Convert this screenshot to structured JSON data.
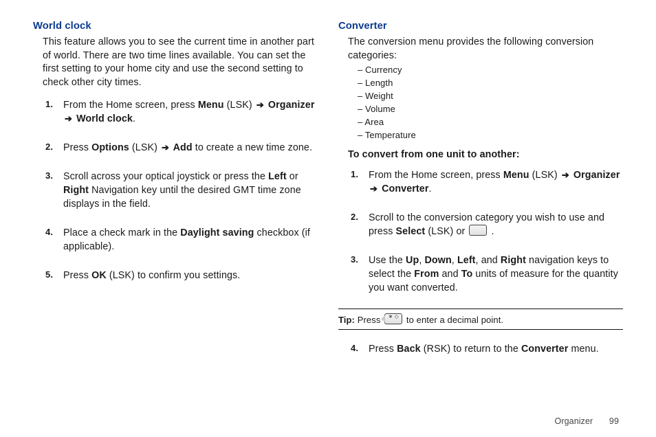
{
  "left": {
    "title": "World clock",
    "intro": "This feature allows you to see the current time in another part of world. There are two time lines available. You can set the first setting to your home city and use the second setting to check other city times.",
    "s1_a": "From the Home screen, press ",
    "s1_menu": "Menu",
    "s1_lsk": " (LSK) ",
    "s1_org": " Organizer ",
    "s1_wc": " World clock",
    "s2_a": "Press ",
    "s2_opt": "Options",
    "s2_lsk": " (LSK) ",
    "s2_add": " Add",
    "s2_tail": " to create a new time zone.",
    "s3_a": "Scroll across your optical joystick or press the ",
    "s3_left": "Left",
    "s3_or": " or ",
    "s3_right": "Right",
    "s3_tail": " Navigation key until the desired GMT time zone displays in the field.",
    "s4_a": "Place a check mark in the ",
    "s4_ds": "Daylight saving",
    "s4_tail": " checkbox (if applicable).",
    "s5_a": "Press ",
    "s5_ok": "OK",
    "s5_tail": " (LSK) to confirm you settings."
  },
  "right": {
    "title": "Converter",
    "intro": "The conversion menu provides the following conversion categories:",
    "cats": [
      "Currency",
      "Length",
      "Weight",
      "Volume",
      "Area",
      "Temperature"
    ],
    "subheader": "To convert from one unit to another:",
    "s1_a": "From the Home screen, press ",
    "s1_menu": "Menu",
    "s1_lsk": " (LSK) ",
    "s1_org": " Organizer ",
    "s1_conv": " Converter",
    "s2_a": "Scroll to the conversion category you wish to use and press ",
    "s2_sel": "Select",
    "s2_lsk": " (LSK) or ",
    "s2_dot": " .",
    "s3_a": "Use the ",
    "s3_up": "Up",
    "s3_c1": ", ",
    "s3_down": "Down",
    "s3_c2": ", ",
    "s3_left": "Left",
    "s3_c3": ", and ",
    "s3_right": "Right",
    "s3_mid": " navigation keys to select the ",
    "s3_from": "From",
    "s3_and": " and ",
    "s3_to": "To",
    "s3_tail": " units of measure for the quantity you want converted.",
    "tip_label": "Tip:",
    "tip_a": " Press ",
    "tip_tail": " to enter a decimal point.",
    "s4_a": "Press ",
    "s4_back": "Back",
    "s4_mid": " (RSK) to return to the ",
    "s4_conv": "Converter",
    "s4_tail": " menu."
  },
  "footer": {
    "section": "Organizer",
    "page": "99"
  }
}
